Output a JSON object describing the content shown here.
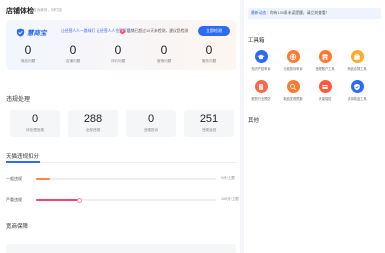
{
  "health": {
    "title": "店铺体检",
    "subtitle": "告诉我问，问叮如",
    "brand": "慧商宝",
    "slogan": "让经营人人一路绿灯 让经营人人也更规范",
    "notice_count": "5",
    "notice": "店铺已超过10天未检测，建议您检测",
    "detect_button": "立即检测",
    "stats": [
      {
        "value": "0",
        "label": "商品问题"
      },
      {
        "value": "0",
        "label": "店铺问题"
      },
      {
        "value": "0",
        "label": "评价问题"
      },
      {
        "value": "0",
        "label": "营销问题"
      },
      {
        "value": "0",
        "label": "服务问题"
      }
    ]
  },
  "violations": {
    "title": "违规处理",
    "cards": [
      {
        "value": "0",
        "label": "待处理违规"
      },
      {
        "value": "288",
        "label": "全部违规"
      },
      {
        "value": "0",
        "label": "违规投诉"
      },
      {
        "value": "251",
        "label": "违规返回"
      }
    ]
  },
  "deduction": {
    "tab": "天猫违规扣分",
    "rows": [
      {
        "label": "一般违规",
        "right": "0分/上限",
        "progress": 0.08,
        "color": "#ff8a3d"
      },
      {
        "label": "严重违规",
        "right": "100分/上限",
        "progress": 0.24,
        "color": "#f0476a"
      }
    ]
  },
  "guarantee": {
    "title": "宽商保障"
  },
  "sidebar": {
    "announce_tag": "最新动态",
    "announce_text": "：你有103条未读提醒，请立刻查看！",
    "tools_title": "工具箱",
    "tools": [
      {
        "label": "知识产权申诉",
        "icon": "graduation-icon",
        "color": "#2c6bf5"
      },
      {
        "label": "行政投诉申诉",
        "icon": "globe-icon",
        "color": "#ff7a2f"
      },
      {
        "label": "违规账户工具",
        "icon": "store-icon",
        "color": "#ff7a2f"
      },
      {
        "label": "商品合规工具",
        "icon": "shop-icon",
        "color": "#ffaa2c"
      },
      {
        "label": "假冒行业预防",
        "icon": "document-icon",
        "color": "#f56a4a"
      },
      {
        "label": "新品发现预报",
        "icon": "search-icon",
        "color": "#ff7a2f"
      },
      {
        "label": "天猫保险",
        "icon": "card-icon",
        "color": "#ff5b3a"
      },
      {
        "label": "手持检品工具",
        "icon": "shield-icon",
        "color": "#2c6bf5"
      }
    ],
    "other_title": "其他"
  }
}
